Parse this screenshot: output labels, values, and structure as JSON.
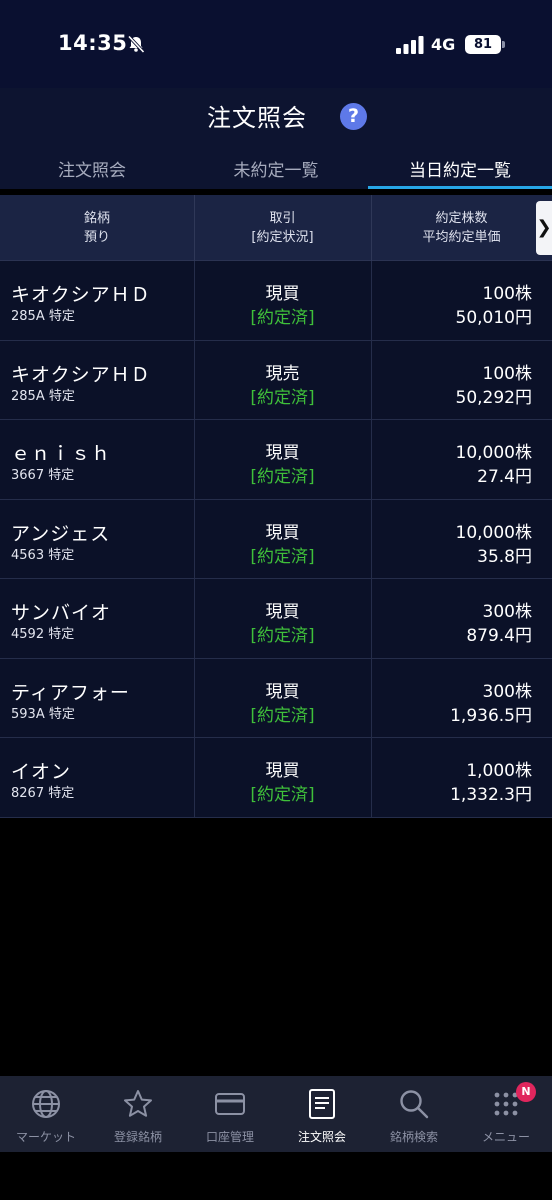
{
  "status_bar": {
    "time": "14:35",
    "network": "4G",
    "battery": "81"
  },
  "header": {
    "title": "注文照会",
    "help_label": "?"
  },
  "tabs": [
    {
      "label": "注文照会"
    },
    {
      "label": "未約定一覧"
    },
    {
      "label": "当日約定一覧"
    }
  ],
  "table": {
    "headers": {
      "col1_line1": "銘柄",
      "col1_line2": "預り",
      "col2_line1": "取引",
      "col2_line2": "[約定状況]",
      "col3_line1": "約定株数",
      "col3_line2": "平均約定単価",
      "scroll": "❯"
    },
    "rows": [
      {
        "name": "キオクシアＨＤ",
        "code": "285A 特定",
        "trade": "現買",
        "status": "[約定済]",
        "qty": "100株",
        "price": "50,010円"
      },
      {
        "name": "キオクシアＨＤ",
        "code": "285A 特定",
        "trade": "現売",
        "status": "[約定済]",
        "qty": "100株",
        "price": "50,292円"
      },
      {
        "name": "ｅｎｉｓｈ",
        "code": "3667 特定",
        "trade": "現買",
        "status": "[約定済]",
        "qty": "10,000株",
        "price": "27.4円"
      },
      {
        "name": "アンジェス",
        "code": "4563 特定",
        "trade": "現買",
        "status": "[約定済]",
        "qty": "10,000株",
        "price": "35.8円"
      },
      {
        "name": "サンバイオ",
        "code": "4592 特定",
        "trade": "現買",
        "status": "[約定済]",
        "qty": "300株",
        "price": "879.4円"
      },
      {
        "name": "ティアフォー",
        "code": "593A 特定",
        "trade": "現買",
        "status": "[約定済]",
        "qty": "300株",
        "price": "1,936.5円"
      },
      {
        "name": "イオン",
        "code": "8267 特定",
        "trade": "現買",
        "status": "[約定済]",
        "qty": "1,000株",
        "price": "1,332.3円"
      }
    ]
  },
  "nav": {
    "items": [
      {
        "label": "マーケット",
        "icon": "globe-icon"
      },
      {
        "label": "登録銘柄",
        "icon": "star-icon"
      },
      {
        "label": "口座管理",
        "icon": "card-icon"
      },
      {
        "label": "注文照会",
        "icon": "document-icon"
      },
      {
        "label": "銘柄検索",
        "icon": "search-icon"
      },
      {
        "label": "メニュー",
        "icon": "grid-icon"
      }
    ],
    "badge": "N"
  },
  "colors": {
    "header_bg": "#0d1430",
    "accent": "#27a6e6",
    "status_green": "#3fbf3a",
    "help_blue": "#5e79e8",
    "badge_red": "#e0265d"
  }
}
